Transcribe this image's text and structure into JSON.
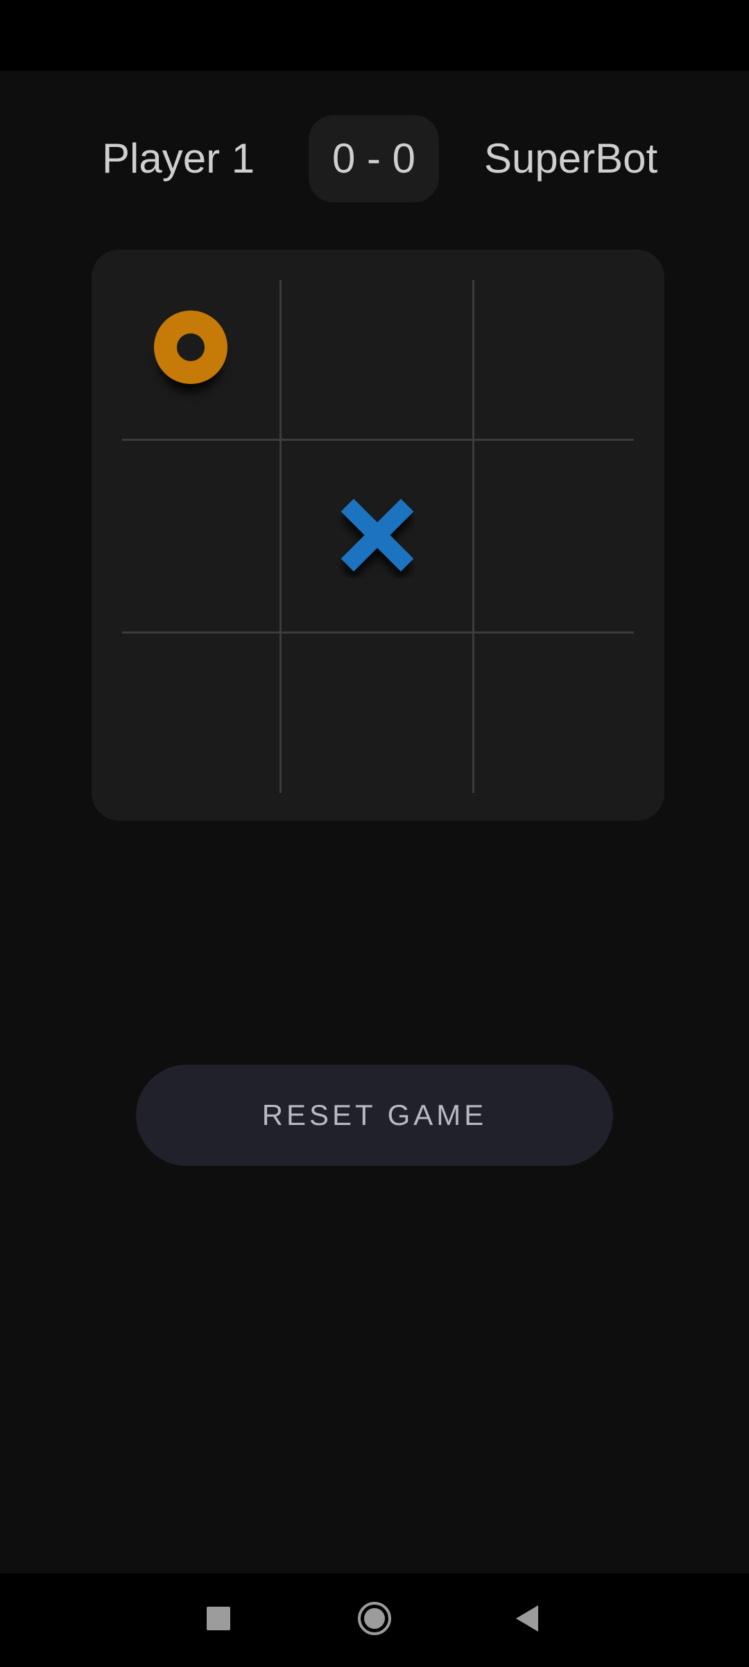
{
  "scoreboard": {
    "player_left": "Player 1",
    "score": "0 - 0",
    "player_right": "SuperBot"
  },
  "board": {
    "cells": [
      "O",
      "",
      "",
      "",
      "X",
      "",
      "",
      "",
      ""
    ]
  },
  "colors": {
    "o_mark": "#c67a07",
    "x_mark": "#1f73bf",
    "background": "#0e0e0e",
    "board": "#1b1b1b"
  },
  "actions": {
    "reset_label": "RESET GAME"
  },
  "nav": {
    "icons": [
      "recents-square-icon",
      "home-circle-icon",
      "back-triangle-icon"
    ]
  }
}
